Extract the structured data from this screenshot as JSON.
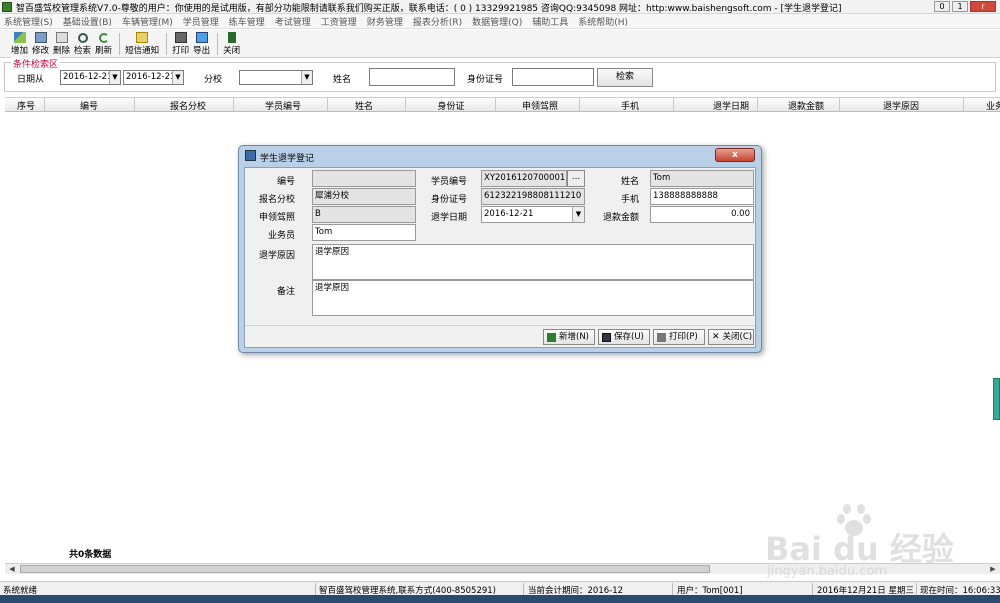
{
  "window": {
    "title": "智百盛驾校管理系统V7.0-尊敬的用户：你使用的是试用版，有部分功能限制请联系我们购买正版，联系电话：( 0 ) 13329921985 咨询QQ:9345098 网址：http:www.baishengsoft.com - [学生退学登记]",
    "minimize": "0",
    "restore": "1",
    "close": "r"
  },
  "menu": [
    "系统管理(S)",
    "基础设置(B)",
    "车辆管理(M)",
    "学员管理",
    "练车管理",
    "考试管理",
    "工资管理",
    "财务管理",
    "报表分析(R)",
    "数据管理(Q)",
    "辅助工具",
    "系统帮助(H)"
  ],
  "toolbar": {
    "add": "增加",
    "edit": "修改",
    "delete": "删除",
    "search": "检索",
    "refresh": "刷新",
    "sms": "短信通知",
    "print": "打印",
    "export": "导出",
    "close": "关闭"
  },
  "conditions": {
    "title": "条件检索区",
    "date_from_label": "日期从",
    "date_from": "2016-12-21",
    "date_to": "2016-12-21",
    "branch_label": "分校",
    "branch_value": "",
    "name_label": "姓名",
    "name_value": "",
    "idcard_label": "身份证号",
    "idcard_value": "",
    "search_button": "检索"
  },
  "grid": {
    "columns": [
      "序号",
      "编号",
      "报名分校",
      "学员编号",
      "姓名",
      "身份证",
      "申领驾照",
      "手机",
      "退学日期",
      "退款金额",
      "退学原因",
      "业务"
    ],
    "count_text": "共0条数据"
  },
  "dialog": {
    "title": "学生退学登记",
    "close": "x",
    "fields": {
      "code_label": "编号",
      "code_value": "",
      "student_no_label": "学员编号",
      "student_no_value": "XY2016120700001",
      "student_no_browse": "...",
      "name_label": "姓名",
      "name_value": "Tom",
      "branch_label": "报名分校",
      "branch_value": "犀浦分校",
      "idcard_label": "身份证号",
      "idcard_value": "612322198808111210",
      "mobile_label": "手机",
      "mobile_value": "138888888888",
      "license_label": "申领驾照",
      "license_value": "B",
      "withdraw_date_label": "退学日期",
      "withdraw_date_value": "2016-12-21",
      "refund_label": "退款金额",
      "refund_value": "0.00",
      "agent_label": "业务员",
      "agent_value": "Tom",
      "reason_label": "退学原因",
      "reason_value": "退学原因",
      "remark_label": "备注",
      "remark_value": "退学原因"
    },
    "buttons": {
      "new": "新增(N)",
      "save": "保存(U)",
      "print": "打印(P)",
      "close": "关闭(C)"
    }
  },
  "statusbar": {
    "ready": "系统就绪",
    "company": "智百盛驾校管理系统,联系方式(400-8505291)",
    "period": "当前会计期间：2016-12",
    "user": "用户：Tom[001]",
    "date": "2016年12月21日 星期三",
    "time": "现在时间：16:06:33"
  },
  "watermark": {
    "main": "Bai du 经验",
    "sub": "jingyan.baidu.com"
  }
}
